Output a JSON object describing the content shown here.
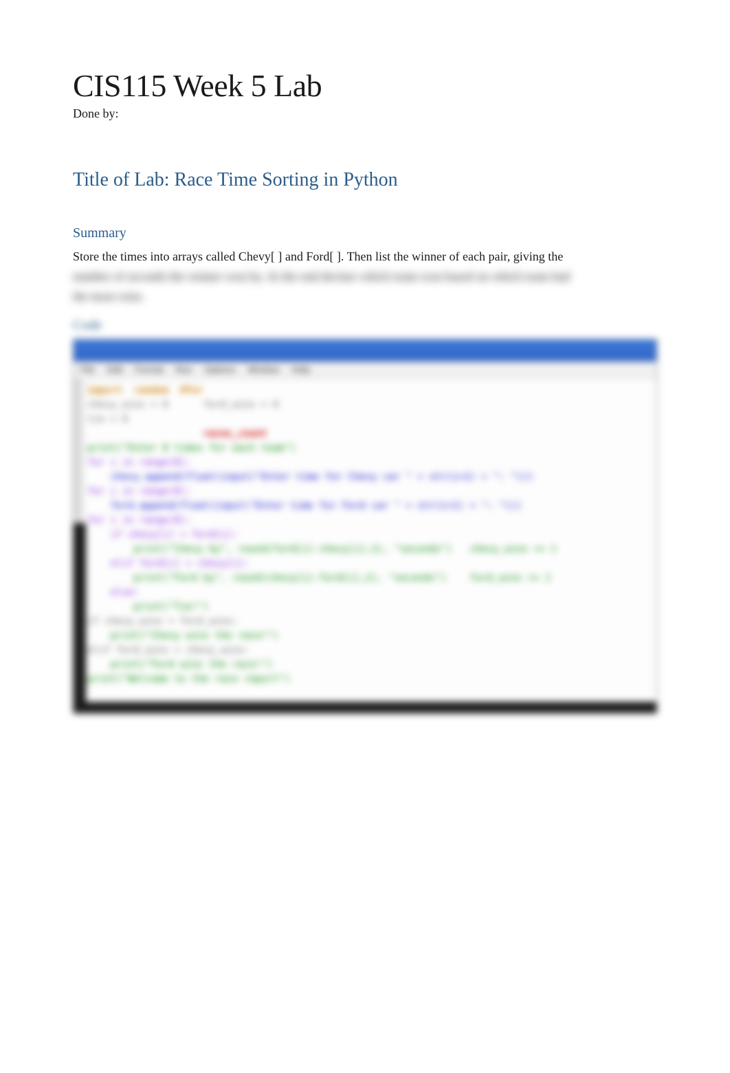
{
  "doc": {
    "title": "CIS115 Week 5 Lab",
    "done_by_label": "Done by:",
    "lab_title": "Title of Lab: Race Time Sorting in Python"
  },
  "summary": {
    "heading": "Summary",
    "visible_line": "Store the times into arrays called Chevy[ ] and Ford[ ]. Then list the winner of each pair, giving the",
    "blurred_line_1": "number of seconds the winner won by. At the end declare which team won based on which team had",
    "blurred_line_2": "the most wins."
  },
  "code_section": {
    "heading": "Code"
  },
  "ide": {
    "menu": [
      "File",
      "Edit",
      "Format",
      "Run",
      "Options",
      "Window",
      "Help"
    ],
    "lines": [
      {
        "cls": "kw-orange",
        "text": "import  random  #for"
      },
      {
        "cls": "kw-gray",
        "text": "chevy_wins = 0      ford_wins = 0"
      },
      {
        "cls": "kw-gray",
        "text": "tie = 0             "
      },
      {
        "cls": "kw-red",
        "text": "                    races_count"
      },
      {
        "cls": "kw-green",
        "text": "print(\"Enter 8 times for each team\")"
      },
      {
        "cls": "kw-purple",
        "text": "for i in range(8):"
      },
      {
        "cls": "kw-blue",
        "text": "    chevy.append(float(input(\"Enter time for Chevy car \" + str(i+1) + \": \")))"
      },
      {
        "cls": "kw-purple",
        "text": "for i in range(8):"
      },
      {
        "cls": "kw-blue",
        "text": "    ford.append(float(input(\"Enter time for Ford car \" + str(i+1) + \": \")))"
      },
      {
        "cls": "kw-purple",
        "text": "for i in range(8):"
      },
      {
        "cls": "kw-purple",
        "text": "    if chevy[i] < ford[i]:"
      },
      {
        "cls": "kw-green",
        "text": "        print(\"Chevy by\", round(ford[i]-chevy[i],2), \"seconds\")   chevy_wins += 1"
      },
      {
        "cls": "kw-purple",
        "text": "    elif ford[i] < chevy[i]:"
      },
      {
        "cls": "kw-green",
        "text": "        print(\"Ford by\", round(chevy[i]-ford[i],2), \"seconds\")    ford_wins += 1"
      },
      {
        "cls": "kw-purple",
        "text": "    else:"
      },
      {
        "cls": "kw-green",
        "text": "        print(\"Tie!\")"
      },
      {
        "cls": "kw-gray",
        "text": "if chevy_wins > ford_wins:"
      },
      {
        "cls": "kw-green",
        "text": "    print(\"Chevy wins the race!\")"
      },
      {
        "cls": "kw-gray",
        "text": "elif ford_wins > chevy_wins:"
      },
      {
        "cls": "kw-green",
        "text": "    print(\"Ford wins the race!\")"
      },
      {
        "cls": "kw-green",
        "text": "print(\"Welcome to the race report\")"
      }
    ]
  }
}
